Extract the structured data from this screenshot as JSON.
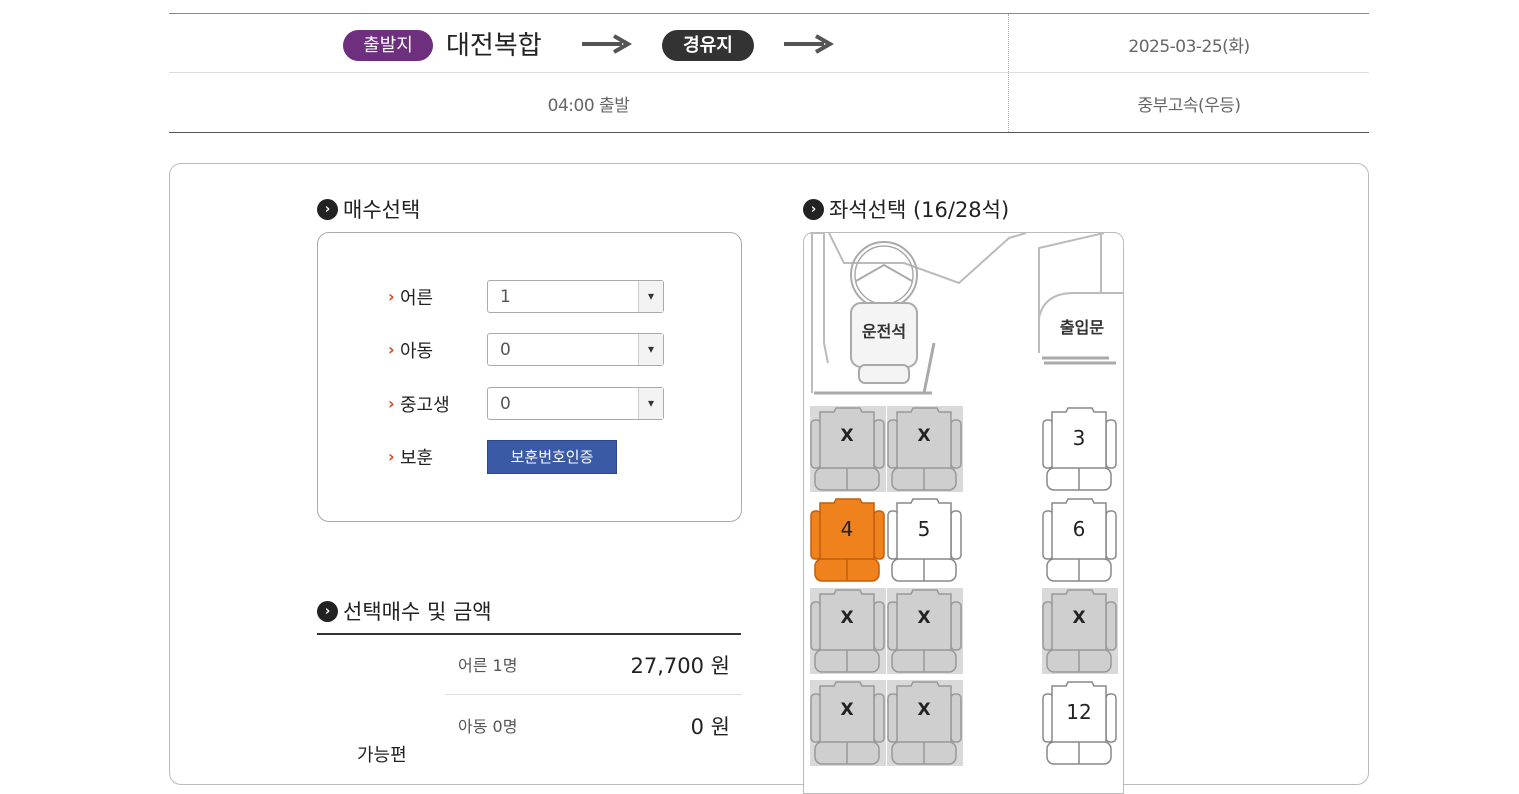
{
  "route": {
    "departure_badge": "출발지",
    "departure_name": "대전복합",
    "via_badge": "경유지",
    "date": "2025-03-25(화)",
    "departure_time": "04:00 출발",
    "bus_company": "중부고속(우등)"
  },
  "ticket_count": {
    "title": "매수선택",
    "rows": [
      {
        "label": "어른",
        "value": "1"
      },
      {
        "label": "아동",
        "value": "0"
      },
      {
        "label": "중고생",
        "value": "0"
      }
    ],
    "veteran_label": "보훈",
    "veteran_button": "보훈번호인증"
  },
  "seat_select": {
    "title": "좌석선택 (16/28석)",
    "driver_label": "운전석",
    "door_label": "출입문",
    "x_mark": "X",
    "seats": [
      {
        "state": "sold"
      },
      {
        "state": "sold"
      },
      {
        "num": "3",
        "state": "available"
      },
      {
        "num": "4",
        "state": "selected"
      },
      {
        "num": "5",
        "state": "available"
      },
      {
        "num": "6",
        "state": "available"
      },
      {
        "state": "sold"
      },
      {
        "state": "sold"
      },
      {
        "state": "sold"
      },
      {
        "state": "sold"
      },
      {
        "state": "sold"
      },
      {
        "num": "12",
        "state": "available"
      }
    ]
  },
  "summary": {
    "title": "선택매수 및 금액",
    "rows": [
      {
        "label": "어른 1명",
        "amount": "27,700 원"
      },
      {
        "label": "아동 0명",
        "amount": "0 원"
      }
    ],
    "side_label": "가능편"
  },
  "colors": {
    "departure_badge": "#6d2f7e",
    "via_badge": "#333333",
    "selected_seat": "#f0821e",
    "sold_seat": "#d9d9d9",
    "veteran_button": "#3a5aa6"
  }
}
